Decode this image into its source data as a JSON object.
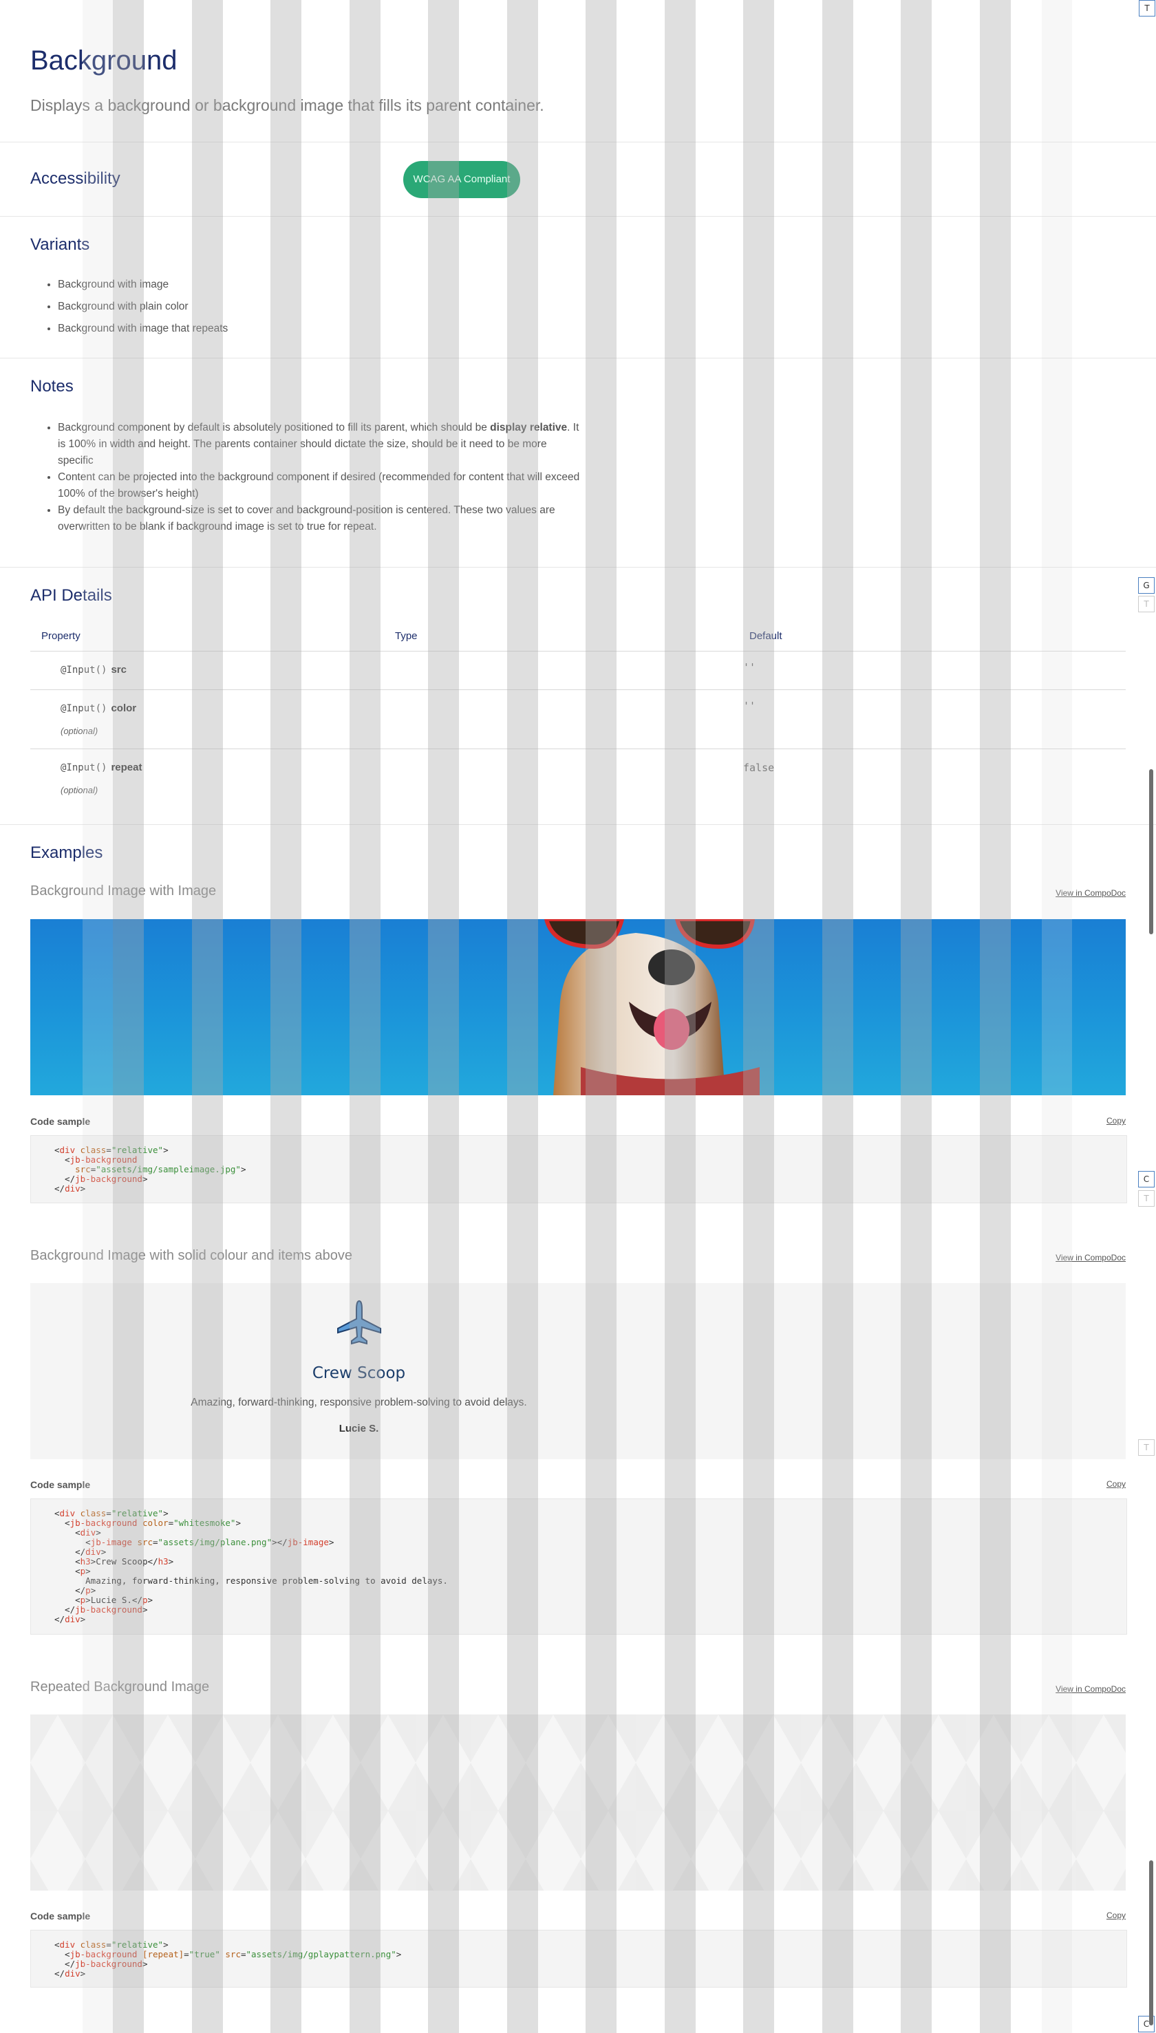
{
  "header": {
    "title": "Background",
    "description": "Displays a background or background image that fills its parent container."
  },
  "accessibility": {
    "heading": "Accessibility",
    "badge": "WCAG AA Compliant",
    "badge_color": "#2aa876"
  },
  "variants": {
    "heading": "Variants",
    "items": [
      "Background with image",
      "Background with plain color",
      "Background with image that repeats"
    ]
  },
  "notes": {
    "heading": "Notes",
    "item1_a": "Background component by default is absolutely positioned to fill its parent, which should be ",
    "item1_bold": "display relative",
    "item1_b": ". It is 100% in width and height. The parents container should dictate the size, should be it need to be more specific",
    "item2": "Content can be projected into the background component if desired (recommended for content that will exceed 100% of the browser's height)",
    "item3": "By default the background-size is set to cover and background-position is centered. These two values are overwritten to be blank if background image is set to true for repeat."
  },
  "api": {
    "heading": "API Details",
    "columns": [
      "Property",
      "Type",
      "Default"
    ],
    "rows": [
      {
        "decorator": "@Input()",
        "name": "src",
        "optional": "",
        "default": "''"
      },
      {
        "decorator": "@Input()",
        "name": "color",
        "optional": "(optional)",
        "default": "''"
      },
      {
        "decorator": "@Input()",
        "name": "repeat",
        "optional": "(optional)",
        "default": "false"
      }
    ]
  },
  "examples": {
    "heading": "Examples",
    "compodoc_label": "View in CompoDoc",
    "code_label": "Code sample",
    "copy_label": "Copy",
    "ex1": {
      "title": "Background Image with Image"
    },
    "ex2": {
      "title": "Background Image with solid colour and items above",
      "card_title": "Crew Scoop",
      "card_text": "Amazing, forward-thinking, responsive problem-solving to avoid delays.",
      "card_author": "Lucie S."
    },
    "ex3": {
      "title": "Repeated Background Image"
    }
  },
  "code": {
    "ex1": {
      "l1_tag": "div",
      "l1_attr": "class",
      "l1_val": "\"relative\"",
      "l2_tag": "jb-background",
      "l3_attr": "src",
      "l3_val": "\"assets/img/sampleimage.jpg\"",
      "l4_tag": "jb-background",
      "l5_tag": "div"
    },
    "ex2": {
      "l1_tag": "div",
      "l1_attr": "class",
      "l1_val": "\"relative\"",
      "l2_tag": "jb-background",
      "l2_attr": "color",
      "l2_val": "\"whitesmoke\"",
      "l3_tag": "div",
      "l4_tag": "jb-image",
      "l4_attr": "src",
      "l4_val": "\"assets/img/plane.png\"",
      "l4_close": "jb-image",
      "l5_tag": "div",
      "l6_tag": "h3",
      "l6_text": "Crew Scoop",
      "l6_close": "h3",
      "l7_tag": "p",
      "l8_text": "Amazing, forward-thinking, responsive problem-solving to avoid delays.",
      "l9_tag": "p",
      "l10_tag": "p",
      "l10_text": "Lucie S.",
      "l10_close": "p",
      "l11_tag": "jb-background",
      "l12_tag": "div"
    },
    "ex3": {
      "l1_tag": "div",
      "l1_attr": "class",
      "l1_val": "\"relative\"",
      "l2_tag": "jb-background",
      "l2_attr": "[repeat]",
      "l2_val": "\"true\"",
      "l2_attr2": "src",
      "l2_val2": "\"assets/img/gplaypattern.png\"",
      "l3_tag": "jb-background",
      "l4_tag": "div"
    }
  },
  "side_buttons": {
    "top": "T",
    "g": "G",
    "t1": "T",
    "c": "C",
    "t2": "T",
    "t3": "T",
    "bottom": "C"
  }
}
